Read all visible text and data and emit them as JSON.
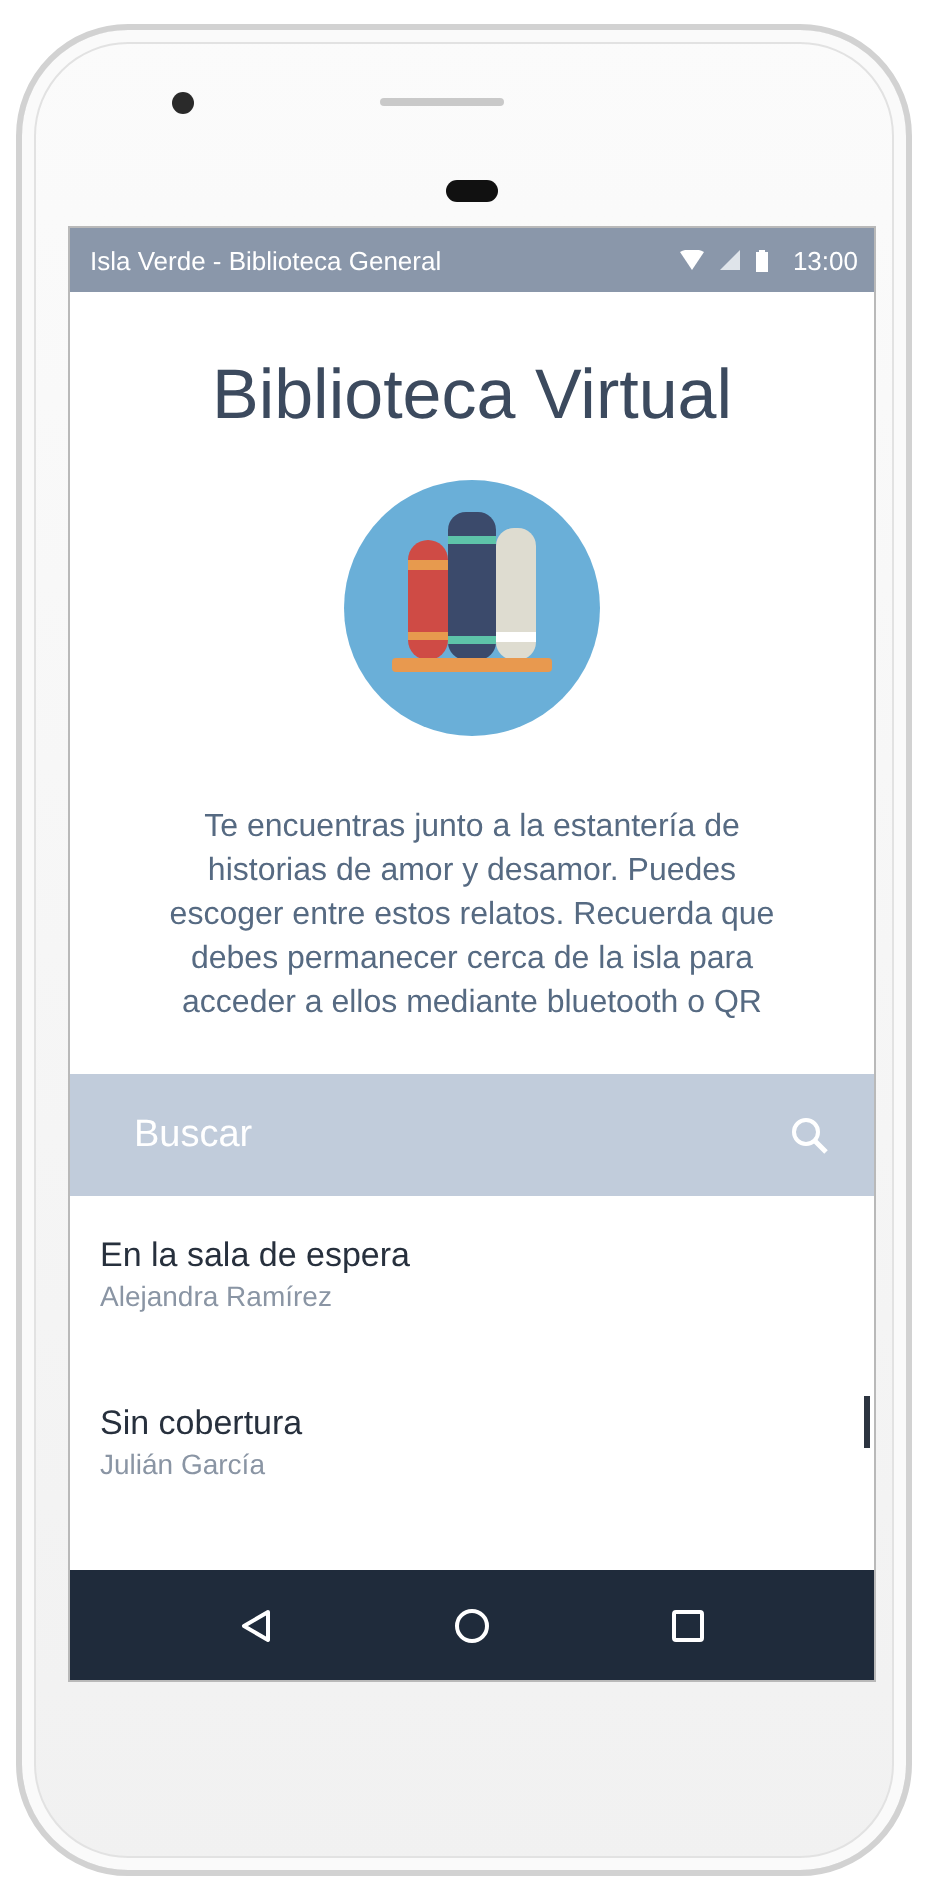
{
  "status_bar": {
    "title": "Isla Verde - Biblioteca General",
    "time": "13:00"
  },
  "title": "Biblioteca Virtual",
  "description": "Te encuentras junto a la estantería de historias de amor y desamor. Puedes escoger entre estos relatos. Recuerda que debes permanecer cerca de la isla para acceder a ellos mediante bluetooth o QR",
  "search": {
    "placeholder": "Buscar"
  },
  "stories": [
    {
      "title": "En la sala de espera",
      "author": "Alejandra Ramírez"
    },
    {
      "title": "Sin cobertura",
      "author": "Julián García"
    }
  ]
}
